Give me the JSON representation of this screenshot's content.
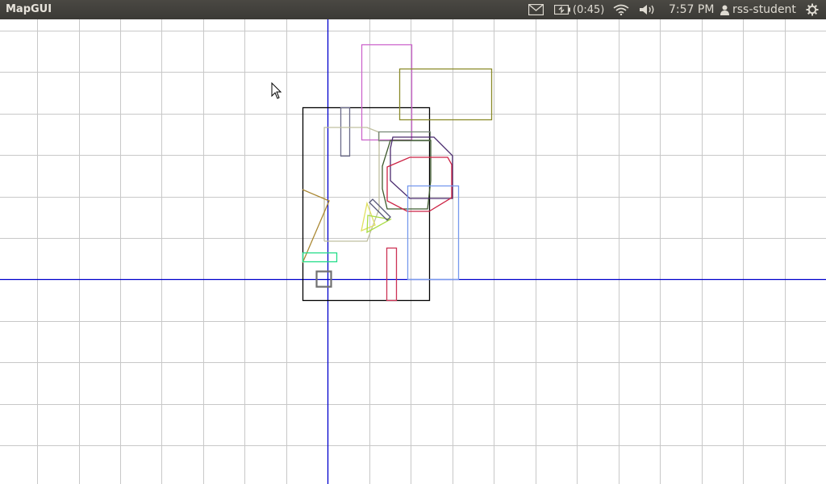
{
  "app": {
    "title": "MapGUI"
  },
  "topbar": {
    "battery_label": "(0:45)",
    "time": "7:57 PM",
    "user": "rss-student",
    "icons": [
      "mail-icon",
      "battery-icon",
      "wifi-icon",
      "volume-icon",
      "user-icon",
      "power-gear-icon"
    ]
  },
  "map": {
    "grid_color": "#c8c8c8",
    "axis_color": "#0000cc",
    "polygon_colors": [
      "#000000",
      "#cc66cc",
      "#8a8a2a",
      "#555577",
      "#6b6b8a",
      "#c0c0a0",
      "#7a8a7a",
      "#3e5a2e",
      "#4a2a6e",
      "#cc2244",
      "#7799ee",
      "#aa8833",
      "#e0e060",
      "#aadd44",
      "#22dd88",
      "#cc3355",
      "#707070"
    ]
  }
}
